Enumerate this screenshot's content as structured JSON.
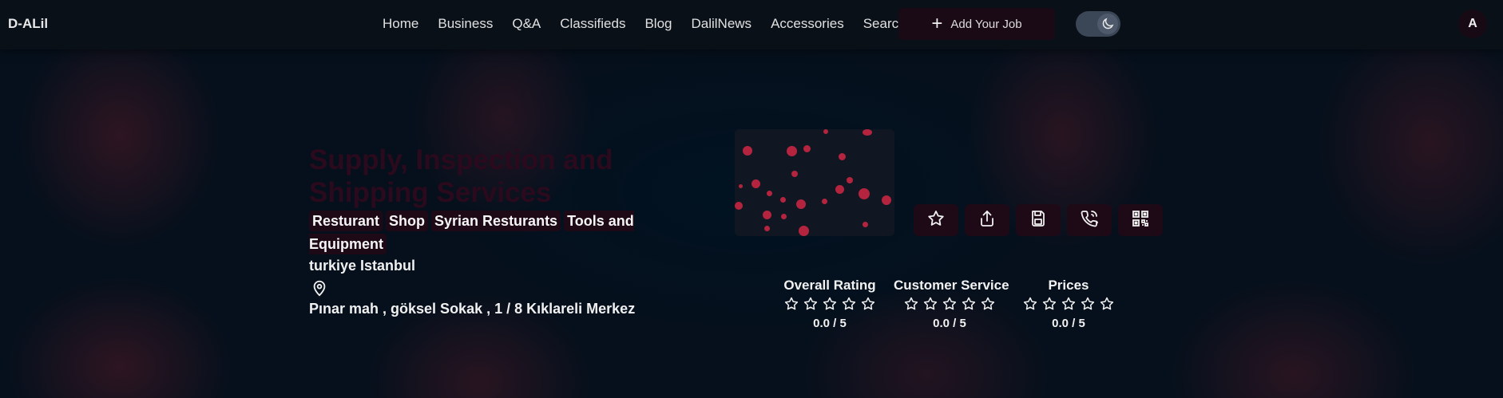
{
  "app": {
    "logo": "D-ALil"
  },
  "nav": {
    "links": [
      "Home",
      "Business",
      "Q&A",
      "Classifieds",
      "Blog",
      "DalilNews",
      "Accessories",
      "Search"
    ],
    "add_job_label": "Add Your Job",
    "avatar_letter": "A"
  },
  "business": {
    "title": "Supply, Inspection and Shipping Services",
    "tags": [
      "Resturant",
      "Shop",
      "Syrian Resturants",
      "Tools and Equipment"
    ],
    "location": "turkiye Istanbul",
    "address": "Pınar mah , göksel Sokak , 1 / 8 Kıklareli Merkez"
  },
  "actions": [
    "star-icon",
    "share-icon",
    "save-icon",
    "phone-icon",
    "qr-code-icon"
  ],
  "ratings": [
    {
      "label": "Overall Rating",
      "value": "0.0 / 5",
      "stars": 0
    },
    {
      "label": "Customer Service",
      "value": "0.0 / 5",
      "stars": 0
    },
    {
      "label": "Prices",
      "value": "0.0 / 5",
      "stars": 0
    }
  ],
  "colors": {
    "background": "#06101c",
    "navbar": "#0a1018",
    "accent_dark": "#1d0a16",
    "dot_accent": "#b4243e",
    "title": "#2a0a1c"
  }
}
